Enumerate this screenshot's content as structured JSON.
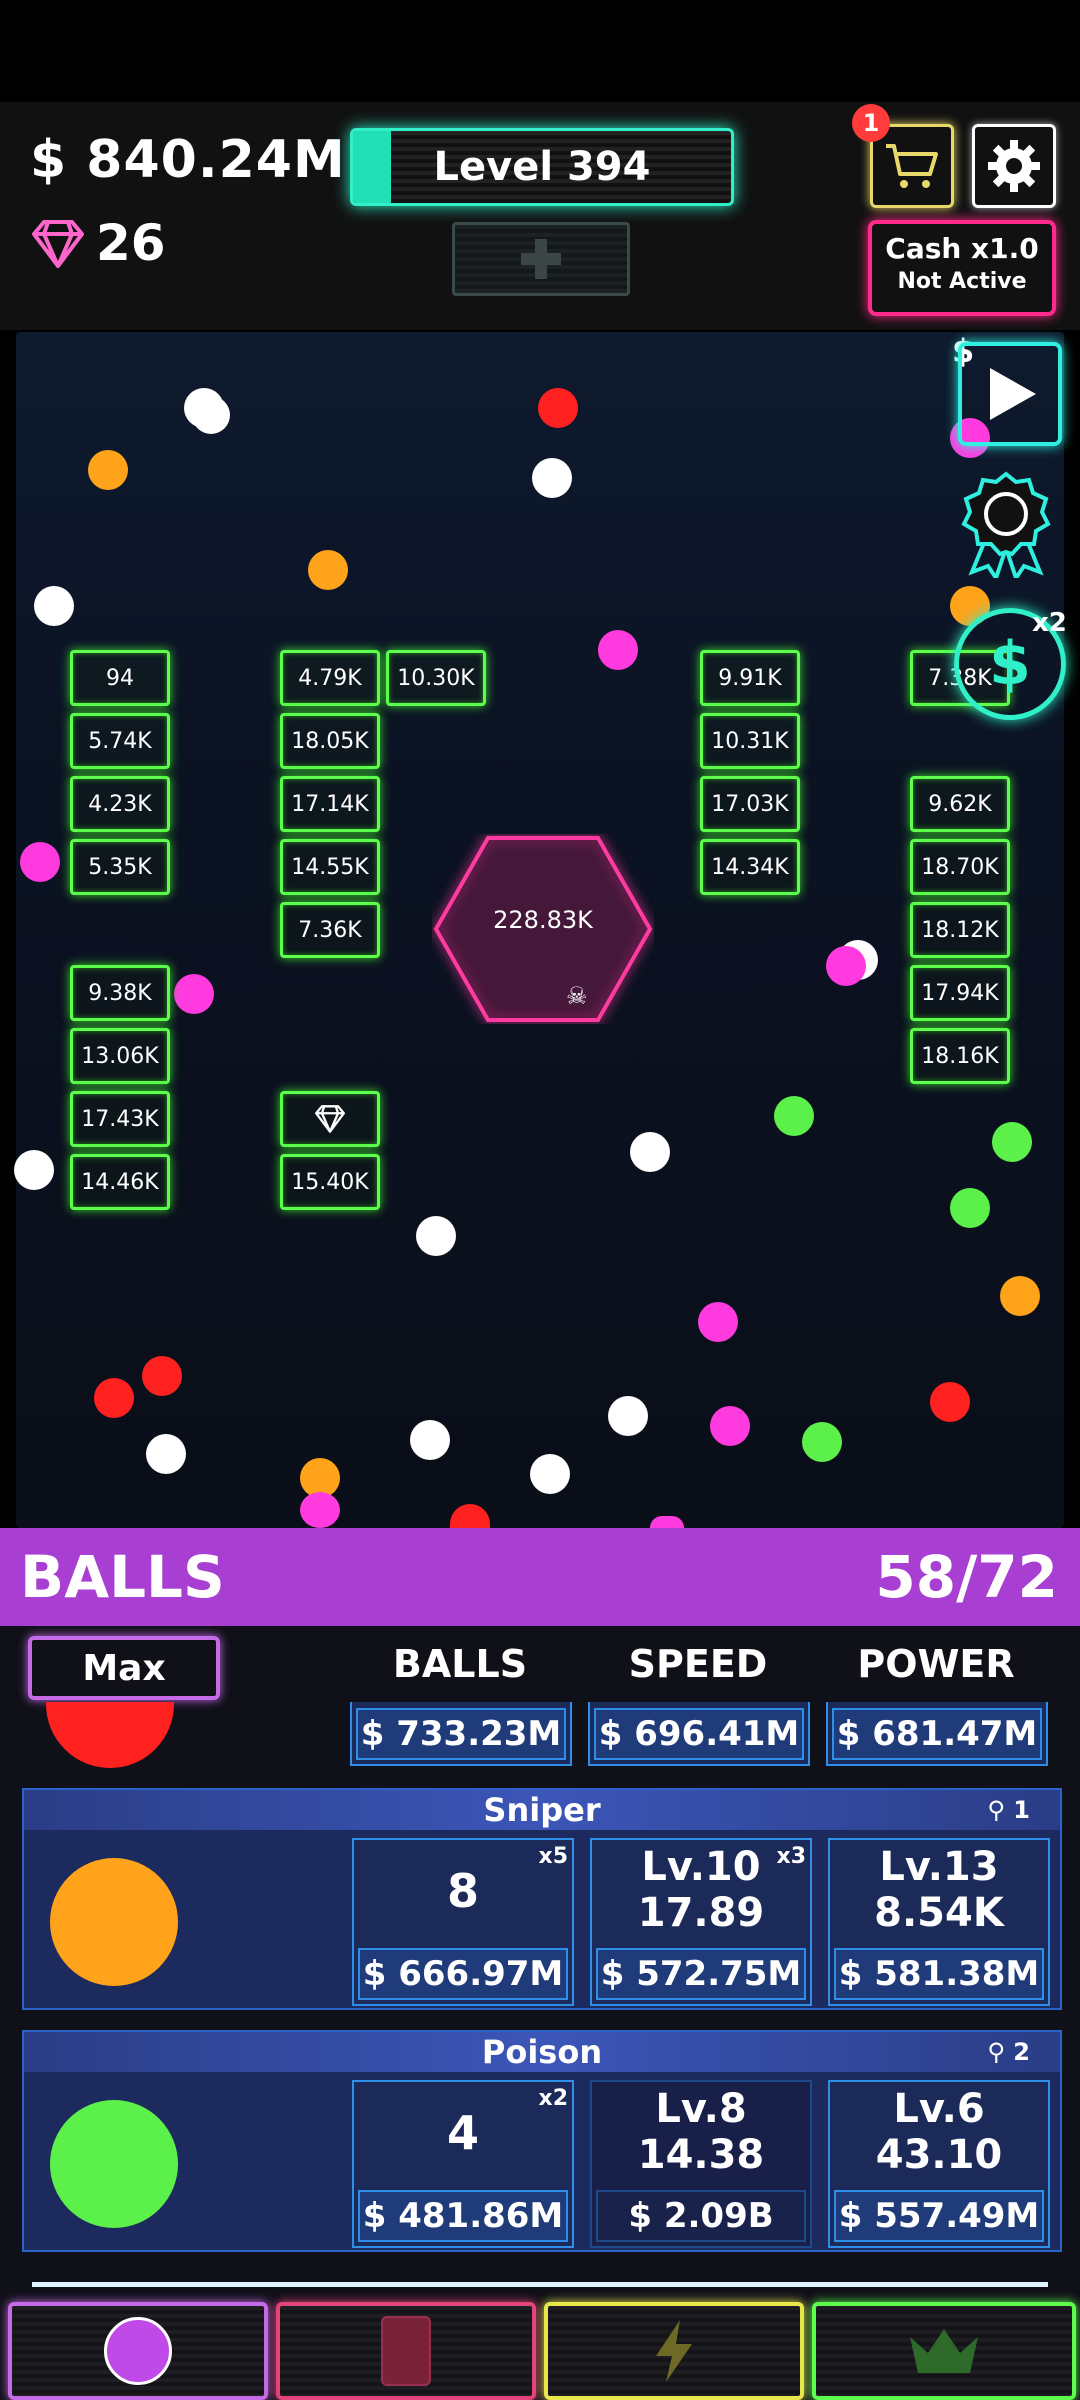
{
  "header": {
    "money": "$ 840.24M",
    "gems": "26",
    "level": "Level 394",
    "level_progress": 0.1,
    "cart_badge": "1",
    "cash_multiplier": "Cash x1.0",
    "cash_status": "Not Active"
  },
  "playfield": {
    "video_bonus_label": "$",
    "coin_multiplier": "x2",
    "hexagon_value": "228.83K",
    "bricks": [
      "94",
      "5.74K",
      "4.23K",
      "5.35K",
      "9.38K",
      "13.06K",
      "17.43K",
      "14.46K",
      "4.79K",
      "18.05K",
      "17.14K",
      "14.55K",
      "7.36K",
      "15.40K",
      "10.30K",
      "9.91K",
      "10.31K",
      "17.03K",
      "14.34K",
      "7.38K",
      "9.62K",
      "18.70K",
      "18.12K",
      "17.94K",
      "18.16K"
    ]
  },
  "panel": {
    "title": "BALLS",
    "count": "58/72",
    "max_label": "Max",
    "columns": [
      "BALLS",
      "SPEED",
      "POWER"
    ],
    "partial_row_prices": [
      "$ 733.23M",
      "$ 696.41M",
      "$ 681.47M"
    ],
    "cards": [
      {
        "name": "Sniper",
        "tag": "1",
        "color": "#ffa31a",
        "balls": {
          "value": "8",
          "mult": "x5",
          "price": "$ 666.97M"
        },
        "speed": {
          "level": "Lv.10",
          "value": "17.89",
          "mult": "x3",
          "price": "$ 572.75M"
        },
        "power": {
          "level": "Lv.13",
          "value": "8.54K",
          "price": "$ 581.38M"
        }
      },
      {
        "name": "Poison",
        "tag": "2",
        "color": "#5cf04a",
        "balls": {
          "value": "4",
          "mult": "x2",
          "price": "$ 481.86M"
        },
        "speed": {
          "level": "Lv.8",
          "value": "14.38",
          "price": "$ 2.09B"
        },
        "power": {
          "level": "Lv.6",
          "value": "43.10",
          "price": "$ 557.49M"
        }
      }
    ]
  },
  "nav": {
    "tabs": [
      "balls-tab",
      "cards-tab",
      "boost-tab",
      "prestige-tab"
    ],
    "colors": [
      "#c56be8",
      "#e2447a",
      "#e8e84a",
      "#5cff4c"
    ]
  }
}
